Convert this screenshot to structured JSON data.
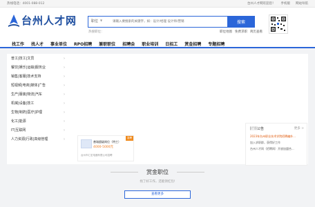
{
  "topbar": {
    "hotline": "热线电话：4001-088-012",
    "links": [
      "台州人才网欢迎您！",
      "手机版",
      "网站导航"
    ]
  },
  "logo": {
    "text": "台州人才网"
  },
  "search": {
    "category": "职位",
    "placeholder": "请输入要搜索的关键字，如：设计/经理 设计师/营销",
    "button": "搜索",
    "hot_label": "热搜职位："
  },
  "header_links": [
    "职位地图",
    "免费求职",
    "简历查看"
  ],
  "nav": [
    "找工作",
    "找人才",
    "事业单位",
    "RPO招聘",
    "兼职职位",
    "招聘会",
    "职业培训",
    "日招工",
    "赏金招聘",
    "专题招聘"
  ],
  "categories": [
    "普工|技工|文员",
    "餐饮|娱乐|运输|服务业",
    "销售|客服|技术支持",
    "短视频|电商|媒体|广告",
    "生产|服装|物流|汽车",
    "机械|设备|技工",
    "生物|制药|医疗|护理",
    "化工|能源",
    "IT|互联网",
    "人力资源|行政|高级管理"
  ],
  "ad_tag": "广告",
  "job_card": {
    "badge": "急聘",
    "title": "普瑞超级岗位（特工）",
    "salary": "4000-5000元",
    "company": "台州市汇宏电器有限公司招聘"
  },
  "notice": {
    "title": "网站公告",
    "more": "更多 >",
    "items": [
      "2023年台州职业技术学院招聘编外...",
      "加入求职群，获得好工作",
      "台州人才网（招聘网）开放加盟合..."
    ]
  },
  "reward": {
    "title": "赏金职位",
    "subtitle": "找了好工作，还能领红包!",
    "more_button": "查看更多"
  }
}
